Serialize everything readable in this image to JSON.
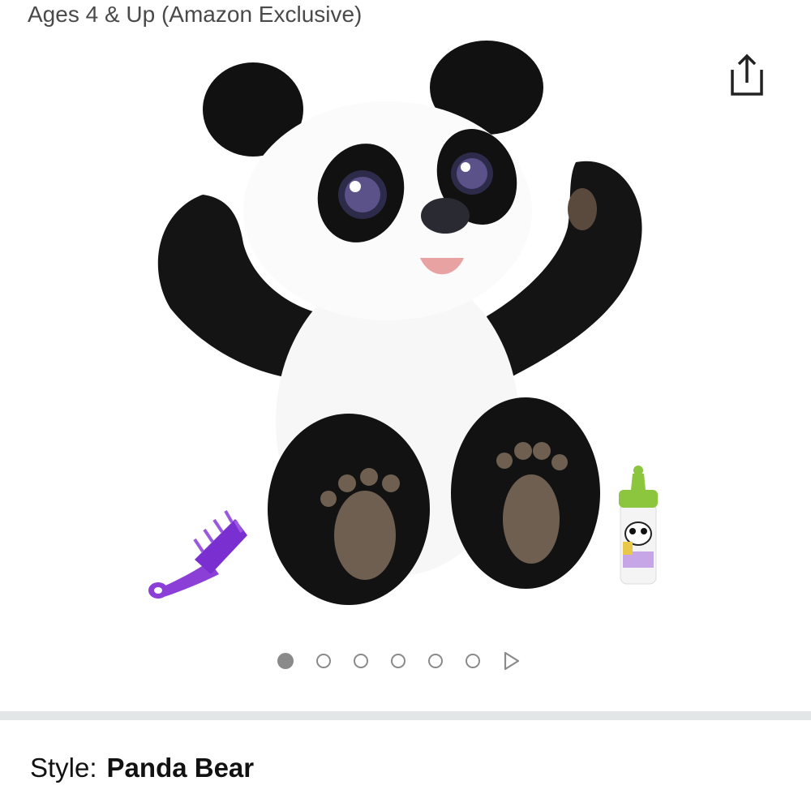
{
  "header": {
    "title_fragment": "Ages 4 & Up (Amazon Exclusive)"
  },
  "icons": {
    "share": "share-icon"
  },
  "gallery": {
    "image_subject": "panda-plush-product-image",
    "current_index": 1,
    "total_dots": 6
  },
  "style": {
    "label": "Style:",
    "value": "Panda Bear"
  }
}
